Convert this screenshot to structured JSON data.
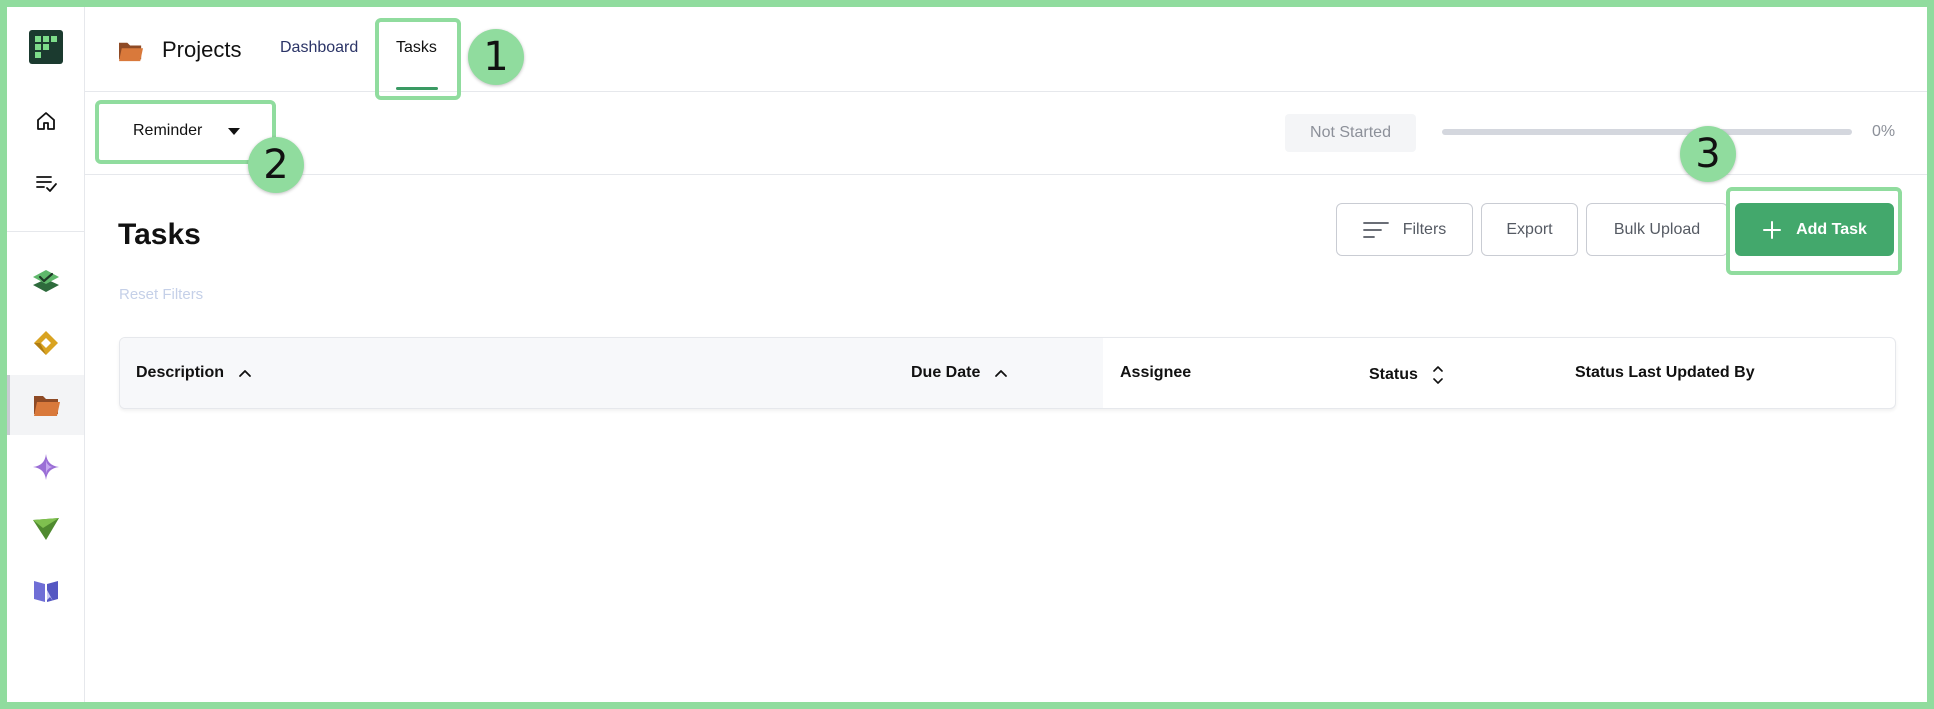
{
  "header": {
    "title": "Projects",
    "tabs": [
      {
        "label": "Dashboard",
        "active": false
      },
      {
        "label": "Tasks",
        "active": true
      }
    ]
  },
  "sidebar": {
    "items": [
      {
        "icon": "brand-logo-icon"
      },
      {
        "icon": "home-icon"
      },
      {
        "icon": "list-check-icon"
      },
      {
        "icon": "stacked-layers-icon"
      },
      {
        "icon": "golden-ring-icon"
      },
      {
        "icon": "folder-icon",
        "active": true
      },
      {
        "icon": "sparkle-icon"
      },
      {
        "icon": "paper-plane-icon"
      },
      {
        "icon": "book-icon"
      }
    ]
  },
  "subbar": {
    "reminder_label": "Reminder",
    "status": "Not Started",
    "progress_percent": 0,
    "progress_text": "0%"
  },
  "main": {
    "heading": "Tasks",
    "reset_filters": "Reset Filters",
    "buttons": {
      "filters": "Filters",
      "export": "Export",
      "bulk_upload": "Bulk Upload",
      "add_task": "Add Task"
    },
    "table": {
      "columns": [
        "Description",
        "Due Date",
        "Assignee",
        "Status",
        "Status Last Updated By"
      ]
    }
  },
  "annotations": [
    "1",
    "2",
    "3"
  ],
  "colors": {
    "accent": "#43a86c",
    "annotation": "#90dc9e"
  }
}
